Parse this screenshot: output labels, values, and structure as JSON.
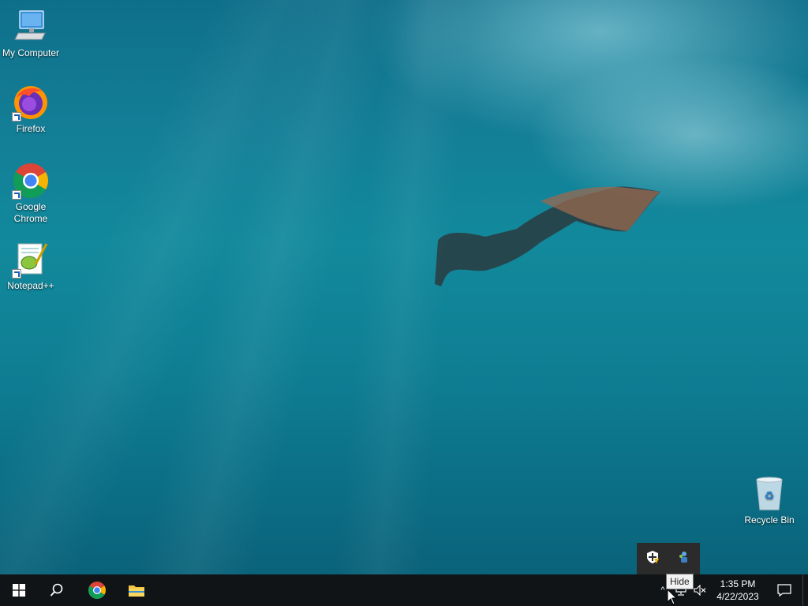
{
  "desktop": {
    "icons": [
      {
        "label": "My Computer",
        "icon": "computer-icon"
      },
      {
        "label": "Firefox",
        "icon": "firefox-icon"
      },
      {
        "label": "Google Chrome",
        "icon": "chrome-icon"
      },
      {
        "label": "Notepad++",
        "icon": "notepadpp-icon"
      },
      {
        "label": "Recycle Bin",
        "icon": "recycle-bin-icon"
      }
    ]
  },
  "taskbar": {
    "buttons": [
      {
        "name": "start-button",
        "icon": "windows-logo-icon"
      },
      {
        "name": "search-button",
        "icon": "search-icon"
      },
      {
        "name": "chrome-taskbar-button",
        "icon": "chrome-icon"
      },
      {
        "name": "file-explorer-button",
        "icon": "folder-icon"
      }
    ],
    "tray": {
      "clock_time": "1:35 PM",
      "clock_date": "4/22/2023",
      "tooltip": "Hide",
      "hidden_icons": [
        "security-warning-icon",
        "network-people-icon"
      ]
    }
  },
  "colors": {
    "taskbar": "#101417",
    "popup": "#2b2b2b",
    "water": "#12899c"
  }
}
